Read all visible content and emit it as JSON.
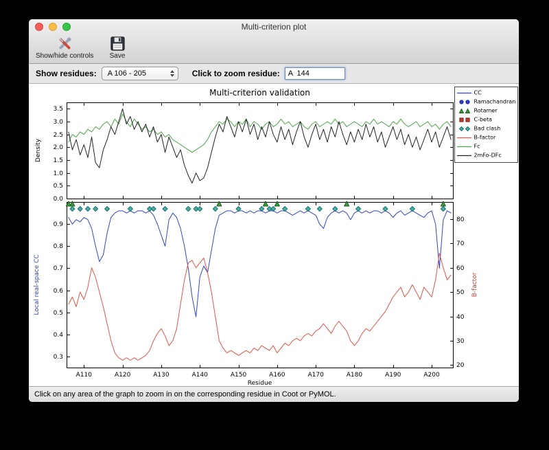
{
  "window": {
    "title": "Multi-criterion plot",
    "toolbar": {
      "show_hide_label": "Show/hide controls",
      "save_label": "Save"
    },
    "controls": {
      "show_residues_label": "Show residues:",
      "residue_range_value": "A 106 - 205",
      "zoom_label": "Click to zoom residue:",
      "zoom_value": "A  144"
    },
    "status_text": "Click on any area of the graph to zoom in on the corresponding residue in Coot or PyMOL."
  },
  "chart_data": {
    "type": "line",
    "title": "Multi-criterion validation",
    "xlabel": "Residue",
    "x_residue_start": 106,
    "x_residue_end": 205,
    "xlim": [
      105.5,
      205.5
    ],
    "x_ticks": [
      "A110",
      "A120",
      "A130",
      "A140",
      "A150",
      "A160",
      "A170",
      "A180",
      "A190",
      "A200"
    ],
    "top": {
      "ylabel": "Density",
      "ylim": [
        0.0,
        3.75
      ],
      "yticks": [
        0.0,
        0.5,
        1.0,
        1.5,
        2.0,
        2.5,
        3.0,
        3.5
      ],
      "series": [
        {
          "name": "Fc",
          "color": "#4da44d",
          "values": [
            2.2,
            2.5,
            2.4,
            2.6,
            2.5,
            2.7,
            2.6,
            2.8,
            2.7,
            2.9,
            3.0,
            2.8,
            3.1,
            2.9,
            3.3,
            3.0,
            2.8,
            3.1,
            2.9,
            2.7,
            2.8,
            2.6,
            2.7,
            2.5,
            2.6,
            2.4,
            2.5,
            2.3,
            2.2,
            2.1,
            2.0,
            1.9,
            1.8,
            1.9,
            2.0,
            2.1,
            2.3,
            2.6,
            2.8,
            3.0,
            2.9,
            3.1,
            3.0,
            2.8,
            3.0,
            2.9,
            3.1,
            2.8,
            3.0,
            2.9,
            2.7,
            2.9,
            3.0,
            2.8,
            2.9,
            3.1,
            2.9,
            3.0,
            2.8,
            2.9,
            3.0,
            2.8,
            2.7,
            2.9,
            3.0,
            2.8,
            2.9,
            3.0,
            2.9,
            3.1,
            2.9,
            3.0,
            2.8,
            2.9,
            3.0,
            2.9,
            2.8,
            3.0,
            2.9,
            3.1,
            2.9,
            3.0,
            2.9,
            2.8,
            3.0,
            2.9,
            3.1,
            2.9,
            2.8,
            2.9,
            3.0,
            2.8,
            2.9,
            3.0,
            2.8,
            2.9,
            2.7,
            2.9,
            3.0,
            2.8
          ]
        },
        {
          "name": "2mFo-DFc",
          "color": "#222222",
          "values": [
            2.6,
            1.9,
            2.3,
            1.7,
            2.1,
            1.6,
            2.4,
            1.4,
            1.2,
            1.9,
            2.3,
            2.8,
            2.5,
            3.0,
            3.5,
            2.9,
            3.2,
            2.7,
            3.0,
            2.6,
            2.9,
            2.4,
            2.8,
            2.2,
            2.5,
            1.8,
            2.4,
            2.0,
            1.6,
            1.9,
            1.3,
            0.9,
            0.6,
            1.0,
            0.7,
            0.8,
            1.2,
            1.8,
            2.4,
            2.9,
            2.6,
            3.2,
            2.8,
            2.4,
            3.0,
            2.6,
            3.1,
            2.5,
            2.9,
            2.3,
            2.8,
            2.4,
            3.0,
            2.5,
            2.2,
            2.8,
            2.3,
            2.7,
            2.1,
            2.6,
            3.0,
            2.4,
            2.0,
            2.5,
            2.9,
            2.3,
            2.7,
            2.2,
            2.8,
            2.4,
            3.0,
            2.5,
            2.1,
            2.6,
            2.2,
            2.7,
            2.3,
            2.9,
            2.4,
            2.8,
            2.2,
            2.6,
            2.0,
            2.4,
            2.8,
            2.3,
            2.7,
            2.1,
            2.5,
            2.0,
            2.4,
            1.9,
            2.3,
            2.7,
            2.2,
            2.6,
            2.0,
            2.4,
            2.8,
            2.3
          ]
        }
      ]
    },
    "bottom": {
      "ylabel_left": "Local real-space CC",
      "ylabel_left_color": "#3246c8",
      "ylim_left": [
        0.25,
        1.0
      ],
      "yticks_left": [
        0.3,
        0.4,
        0.5,
        0.6,
        0.7,
        0.8,
        0.9
      ],
      "ylabel_right": "B-factor",
      "ylabel_right_color": "#cc3b30",
      "ylim_right": [
        19,
        87
      ],
      "yticks_right": [
        20,
        30,
        40,
        50,
        60,
        70,
        80
      ],
      "series": [
        {
          "name": "CC",
          "axis": "left",
          "color": "#3246c8",
          "values": [
            0.93,
            0.9,
            0.92,
            0.91,
            0.93,
            0.92,
            0.88,
            0.8,
            0.73,
            0.76,
            0.86,
            0.93,
            0.95,
            0.96,
            0.96,
            0.95,
            0.96,
            0.95,
            0.96,
            0.96,
            0.95,
            0.96,
            0.94,
            0.9,
            0.85,
            0.8,
            0.92,
            0.95,
            0.93,
            0.88,
            0.8,
            0.7,
            0.57,
            0.48,
            0.66,
            0.71,
            0.68,
            0.78,
            0.88,
            0.94,
            0.95,
            0.96,
            0.96,
            0.95,
            0.96,
            0.96,
            0.95,
            0.96,
            0.95,
            0.96,
            0.96,
            0.95,
            0.96,
            0.96,
            0.95,
            0.96,
            0.96,
            0.95,
            0.94,
            0.95,
            0.96,
            0.95,
            0.96,
            0.95,
            0.94,
            0.9,
            0.88,
            0.93,
            0.95,
            0.96,
            0.95,
            0.96,
            0.95,
            0.92,
            0.95,
            0.96,
            0.95,
            0.96,
            0.95,
            0.96,
            0.96,
            0.95,
            0.96,
            0.95,
            0.93,
            0.95,
            0.96,
            0.94,
            0.95,
            0.96,
            0.95,
            0.94,
            0.93,
            0.95,
            0.96,
            0.9,
            0.7,
            0.92,
            0.96,
            0.95
          ]
        },
        {
          "name": "B-factor",
          "axis": "right",
          "color": "#e0554a",
          "values": [
            45,
            48,
            44,
            50,
            47,
            52,
            60,
            56,
            50,
            44,
            37,
            30,
            25,
            23,
            22,
            23,
            22,
            23,
            22,
            23,
            24,
            26,
            30,
            33,
            35,
            32,
            28,
            30,
            35,
            45,
            55,
            62,
            63,
            60,
            62,
            64,
            58,
            50,
            40,
            30,
            27,
            25,
            26,
            25,
            24,
            25,
            26,
            25,
            27,
            26,
            28,
            27,
            26,
            28,
            25,
            27,
            29,
            28,
            30,
            31,
            30,
            32,
            33,
            32,
            34,
            35,
            37,
            35,
            33,
            36,
            38,
            36,
            34,
            30,
            28,
            30,
            33,
            35,
            34,
            36,
            38,
            40,
            42,
            45,
            48,
            50,
            52,
            48,
            50,
            53,
            50,
            47,
            52,
            50,
            48,
            55,
            66,
            60,
            55,
            57
          ]
        }
      ],
      "markers": {
        "bad_clash": {
          "color": "#45b0a8",
          "edge": "#1d6f6a",
          "residues": [
            107,
            109,
            111,
            113,
            116,
            122,
            127,
            128,
            131,
            137,
            139,
            140,
            144,
            150,
            156,
            158,
            159,
            162,
            168,
            171,
            175,
            181,
            188,
            195,
            203
          ]
        },
        "rotamer": {
          "color": "#3c9a3c",
          "edge": "#1e5c1e",
          "residues": [
            106,
            107,
            145,
            157,
            160,
            178,
            203
          ]
        }
      }
    },
    "legend": [
      {
        "label": "CC",
        "type": "line",
        "color": "#3246c8",
        "edge": "#3246c8"
      },
      {
        "label": "Ramachandran",
        "type": "circles",
        "color": "#2b3fd0",
        "edge": "#1a2a90"
      },
      {
        "label": "Rotamer",
        "type": "triangles",
        "color": "#3c9a3c",
        "edge": "#1e5c1e"
      },
      {
        "label": "C-beta",
        "type": "squares",
        "color": "#c23b2e",
        "edge": "#7a1f18"
      },
      {
        "label": "Bad clash",
        "type": "diamonds",
        "color": "#45b0a8",
        "edge": "#1d6f6a"
      },
      {
        "label": "B-factor",
        "type": "line",
        "color": "#e0554a",
        "edge": "#e0554a"
      },
      {
        "label": "Fc",
        "type": "line",
        "color": "#4da44d",
        "edge": "#4da44d"
      },
      {
        "label": "2mFo-DFc",
        "type": "line",
        "color": "#222222",
        "edge": "#222222"
      }
    ]
  }
}
